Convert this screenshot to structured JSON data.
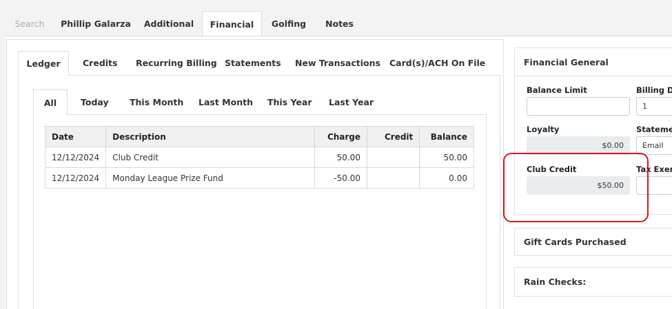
{
  "top_tabs": [
    {
      "label": "Search"
    },
    {
      "label": "Phillip Galarza"
    },
    {
      "label": "Additional"
    },
    {
      "label": "Financial"
    },
    {
      "label": "Golfing"
    },
    {
      "label": "Notes"
    }
  ],
  "sub_tabs": [
    {
      "label": "Ledger"
    },
    {
      "label": "Credits"
    },
    {
      "label": "Recurring Billing"
    },
    {
      "label": "Statements"
    },
    {
      "label": "New Transactions"
    },
    {
      "label": "Card(s)/ACH On File"
    }
  ],
  "period_tabs": [
    {
      "label": "All"
    },
    {
      "label": "Today"
    },
    {
      "label": "This Month"
    },
    {
      "label": "Last Month"
    },
    {
      "label": "This Year"
    },
    {
      "label": "Last Year"
    }
  ],
  "ledger": {
    "headers": {
      "date": "Date",
      "description": "Description",
      "charge": "Charge",
      "credit": "Credit",
      "balance": "Balance"
    },
    "rows": [
      {
        "date": "12/12/2024",
        "description": "Club Credit",
        "charge": "50.00",
        "credit": "",
        "balance": "50.00"
      },
      {
        "date": "12/12/2024",
        "description": "Monday League Prize Fund",
        "charge": "-50.00",
        "credit": "",
        "balance": "0.00"
      }
    ]
  },
  "financial_general": {
    "title": "Financial General",
    "balance_limit": {
      "label": "Balance Limit",
      "value": ""
    },
    "billing_day": {
      "label": "Billing Day",
      "value": "1"
    },
    "loyalty": {
      "label": "Loyalty",
      "value": "$0.00"
    },
    "statement": {
      "label": "Statement",
      "value": "Email"
    },
    "club_credit": {
      "label": "Club Credit",
      "value": "$50.00"
    },
    "tax_exempt": {
      "label": "Tax Exemp",
      "value": ""
    }
  },
  "gift_cards": {
    "title": "Gift Cards Purchased"
  },
  "rain_checks": {
    "title": "Rain Checks:"
  },
  "colors": {
    "highlight": "#d8151e",
    "readonly_bg": "#e9ecef"
  }
}
